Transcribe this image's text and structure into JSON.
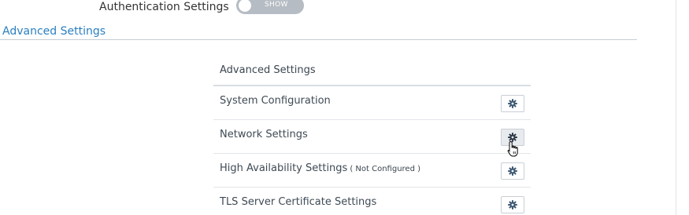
{
  "auth": {
    "label": "Authentication Settings",
    "toggle_text": "SHOW"
  },
  "section": {
    "title": "Advanced Settings"
  },
  "panel": {
    "header": "Advanced Settings",
    "rows": [
      {
        "label": "System Configuration",
        "note": ""
      },
      {
        "label": "Network Settings",
        "note": ""
      },
      {
        "label": "High Availability Settings",
        "note": "( Not Configured )"
      },
      {
        "label": "TLS Server Certificate Settings",
        "note": ""
      }
    ]
  },
  "icons": {
    "row_action": "gear-icon",
    "cursor": "hand-pointer-icon"
  },
  "colors": {
    "accent": "#2a7fc1",
    "toggle_off": "#b6bcc3",
    "gear": "#3d5a73"
  }
}
